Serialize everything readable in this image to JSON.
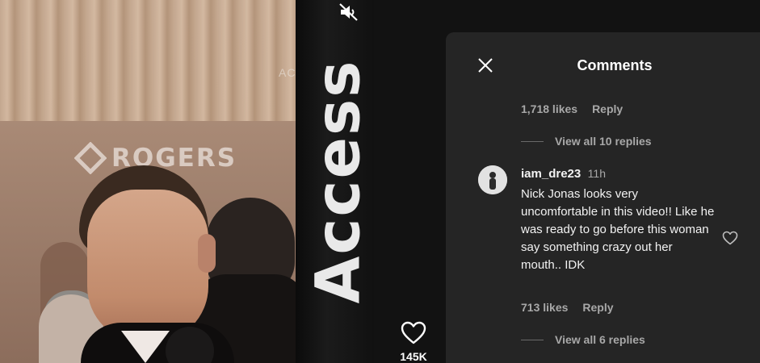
{
  "video": {
    "backdrop_brand": "ROGERS",
    "watermark": "ACCE",
    "sign_text": "Access",
    "mute_icon": "speaker-muted-icon",
    "like_icon": "heart-outline-icon",
    "like_count": "145K"
  },
  "comments_panel": {
    "title": "Comments",
    "close_icon": "close-icon",
    "prev_thread": {
      "likes": "1,718 likes",
      "reply_label": "Reply",
      "view_replies": "View all 10 replies"
    },
    "comment": {
      "username": "iam_dre23",
      "time": "11h",
      "text": "Nick Jonas looks very uncomfortable in this video!! Like he was ready to go before this woman say something crazy out her mouth.. IDK",
      "likes": "713 likes",
      "reply_label": "Reply",
      "view_replies": "View all 6 replies",
      "like_icon": "heart-outline-icon"
    }
  },
  "colors": {
    "page_bg": "#121212",
    "panel_bg": "#252525",
    "primary_text": "#ffffff",
    "secondary_text": "#a8a8a8"
  }
}
